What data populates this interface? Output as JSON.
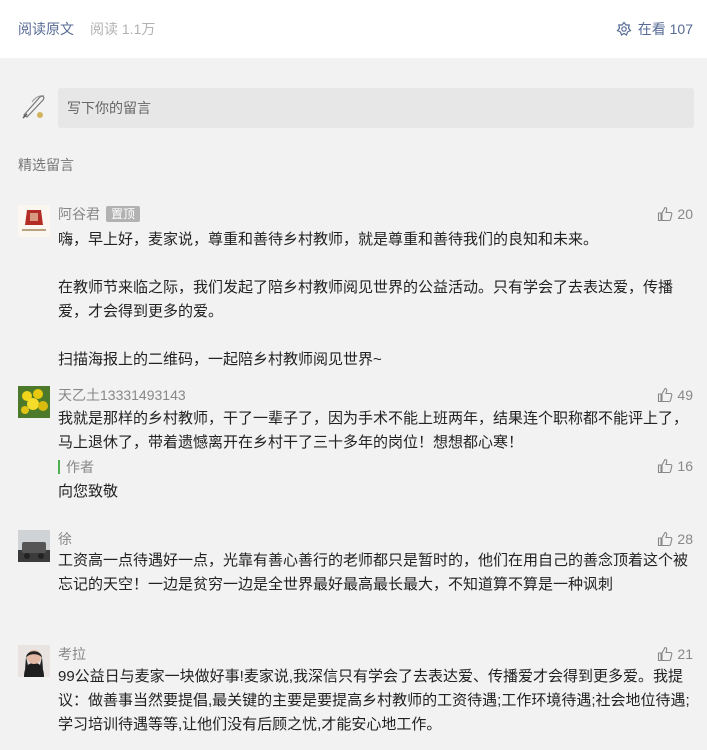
{
  "top": {
    "read_original": "阅读原文",
    "read_count": "阅读 1.1万",
    "in_view": "在看 107"
  },
  "compose": {
    "placeholder": "写下你的留言"
  },
  "section_title": "精选留言",
  "comments": [
    {
      "nickname": "阿谷君",
      "pinned_badge": "置顶",
      "likes": "20",
      "text": "嗨，早上好，麦家说，尊重和善待乡村教师，就是尊重和善待我们的良知和未来。\n\n在教师节来临之际，我们发起了陪乡村教师阅见世界的公益活动。只有学会了去表达爱，传播爱，才会得到更多的爱。\n\n扫描海报上的二维码，一起陪乡村教师阅见世界~"
    },
    {
      "nickname": "天乙土13331493143",
      "likes": "49",
      "text": "我就是那样的乡村教师，干了一辈子了，因为手术不能上班两年，结果连个职称都不能评上了，马上退休了，带着遗憾离开在乡村干了三十多年的岗位！想想都心寒！",
      "reply": {
        "label": "作者",
        "likes": "16",
        "text": "向您致敬"
      }
    },
    {
      "nickname": "徐",
      "likes": "28",
      "text": "工资高一点待遇好一点，光靠有善心善行的老师都只是暂时的，他们在用自己的善念顶着这个被忘记的天空！一边是贫穷一边是全世界最好最高最长最大，不知道算不算是一种讽刺"
    },
    {
      "nickname": "考拉",
      "likes": "21",
      "text": "99公益日与麦家一块做好事!麦家说,我深信只有学会了去表达爱、传播爱才会得到更多爱。我提议：做善事当然要提倡,最关键的主要是要提高乡村教师的工资待遇;工作环境待遇;社会地位待遇;学习培训待遇等等,让他们没有后顾之忧,才能安心地工作。"
    }
  ],
  "colors": {
    "link": "#576b95",
    "muted": "#888888",
    "bg_gray": "#f2f2f2",
    "reply_bar": "#4caf50"
  },
  "icons": [
    "in-view-flower-icon",
    "thumbs-up-icon",
    "quill-avatar-icon"
  ]
}
